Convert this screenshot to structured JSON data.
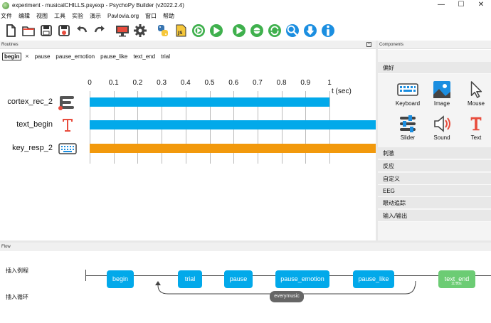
{
  "window": {
    "title": "experiment - musicalCHILLS.psyexp - PsychoPy Builder (v2022.2.4)",
    "minimize": "—",
    "maximize": "☐",
    "close": "✕"
  },
  "menu": [
    "文件",
    "编辑",
    "视图",
    "工具",
    "实验",
    "演示",
    "Pavlovia.org",
    "窗口",
    "帮助"
  ],
  "toolbar": {
    "icons": [
      "new-file",
      "open-folder",
      "save",
      "save-as",
      "undo",
      "redo",
      "monitor",
      "settings",
      "python",
      "js",
      "run-green",
      "play-green",
      "run-pilot",
      "globe-bug",
      "sync",
      "search-user",
      "download",
      "info"
    ],
    "js_label": "JS"
  },
  "routines_panel": {
    "header": "Routines",
    "tabs": [
      {
        "label": "begin",
        "active": true
      },
      {
        "label": "pause"
      },
      {
        "label": "pause_emotion"
      },
      {
        "label": "pause_like"
      },
      {
        "label": "text_end"
      },
      {
        "label": "trial"
      }
    ],
    "tab_close": "×",
    "axis_ticks": [
      "0",
      "0.1",
      "0.2",
      "0.3",
      "0.4",
      "0.5",
      "0.6",
      "0.7",
      "0.8",
      "0.9",
      "1"
    ],
    "axis_unit": "t (sec)",
    "components": [
      {
        "name": "cortex_rec_2",
        "icon": "cortex-icon",
        "color": "#02a9ea",
        "start": 0,
        "end": 1.0
      },
      {
        "name": "text_begin",
        "icon": "text-icon",
        "color": "#02a9ea",
        "start": 0,
        "end": 1.2
      },
      {
        "name": "key_resp_2",
        "icon": "keyboard-icon",
        "color": "#f2990c",
        "start": 0,
        "end": 1.2
      }
    ]
  },
  "components_panel": {
    "header": "Components",
    "categories_top": "偏好",
    "favorites": [
      {
        "label": "Keyboard",
        "icon": "keyboard-icon"
      },
      {
        "label": "Image",
        "icon": "image-icon"
      },
      {
        "label": "Mouse",
        "icon": "mouse-cursor-icon"
      },
      {
        "label": "Slider",
        "icon": "slider-icon"
      },
      {
        "label": "Sound",
        "icon": "sound-icon"
      },
      {
        "label": "Text",
        "icon": "text-icon"
      }
    ],
    "categories": [
      "刺激",
      "反应",
      "自定义",
      "EEG",
      "眼动追踪",
      "输入/输出"
    ]
  },
  "flow": {
    "header": "Flow",
    "insert_routine": "插入例程",
    "insert_loop": "插入循环",
    "nodes": [
      {
        "label": "begin",
        "color": "#02a9ea"
      },
      {
        "label": "trial",
        "color": "#02a9ea"
      },
      {
        "label": "pause",
        "color": "#02a9ea"
      },
      {
        "label": "pause_emotion",
        "color": "#02a9ea"
      },
      {
        "label": "pause_like",
        "color": "#02a9ea"
      },
      {
        "label": "text_end",
        "color": "#6ccc74",
        "sub": "11.00s"
      }
    ],
    "loop": "everymusic"
  }
}
